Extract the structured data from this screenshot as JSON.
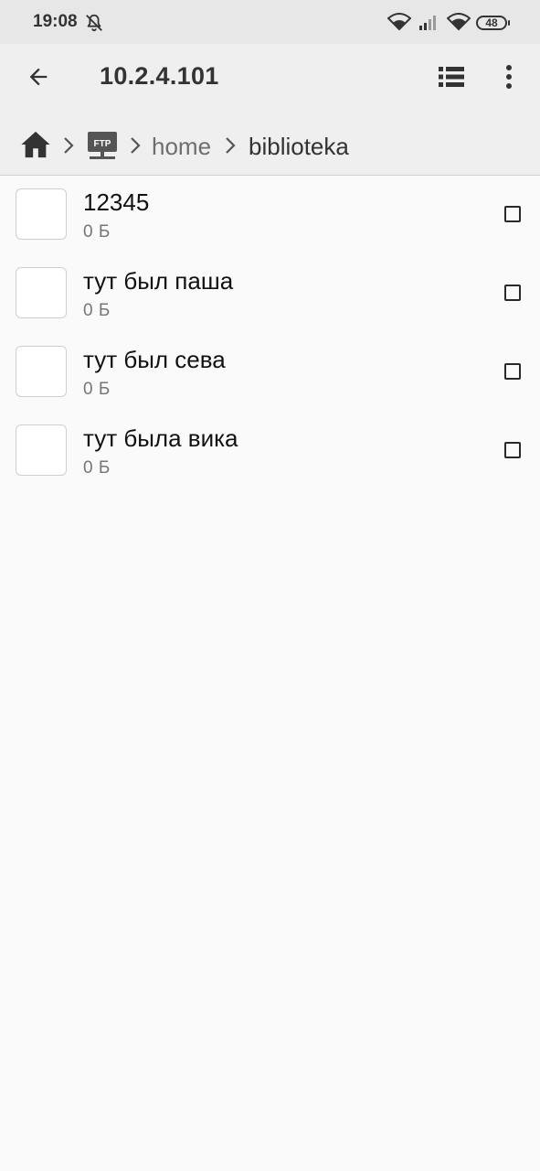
{
  "status_bar": {
    "time": "19:08",
    "battery": "48",
    "icons": [
      "bell-muted-icon",
      "wifi-icon",
      "signal-icon",
      "wifi-icon"
    ]
  },
  "toolbar": {
    "back_icon": "arrow-left-icon",
    "title": "10.2.4.101",
    "view_icon": "list-view-icon",
    "menu_icon": "more-vert-icon"
  },
  "breadcrumb": {
    "home_icon": "home-icon",
    "ftp_label": "FTP",
    "items": [
      "home",
      "biblioteka"
    ]
  },
  "files": [
    {
      "name": "12345",
      "size": "0 Б"
    },
    {
      "name": "тут был паша",
      "size": "0 Б"
    },
    {
      "name": "тут был сева",
      "size": "0 Б"
    },
    {
      "name": "тут была вика",
      "size": "0 Б"
    }
  ],
  "colors": {
    "status_bar_bg": "#e7e7e7",
    "toolbar_bg": "#efefef",
    "content_bg": "#fafafa",
    "text_primary": "#111111",
    "text_secondary": "#767676"
  }
}
